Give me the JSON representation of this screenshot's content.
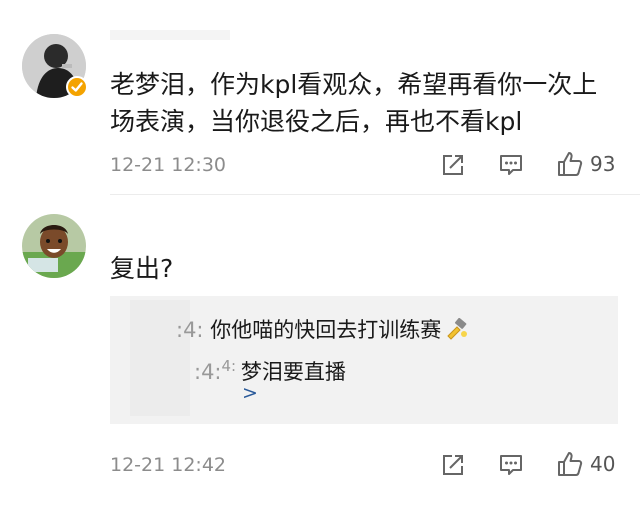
{
  "comments": [
    {
      "text": "老梦泪，作为kpl看观众，希望再看你一次上场表演，当你退役之后，再也不看kpl",
      "time": "12-21 12:30",
      "likes": "93",
      "verified_badge": "verified-icon"
    },
    {
      "text": "复出?",
      "time": "12-21 12:42",
      "likes": "40",
      "replies": [
        {
          "name": ":4:",
          "text": "你他喵的快回去打训练赛"
        },
        {
          "name": ":4:",
          "name2": "4: ",
          "text": "梦泪要直播"
        }
      ],
      "more_label": ">"
    }
  ],
  "colors": {
    "accent": "#f4a300",
    "link": "#2a5a9a",
    "meta": "#8c8c8c"
  }
}
